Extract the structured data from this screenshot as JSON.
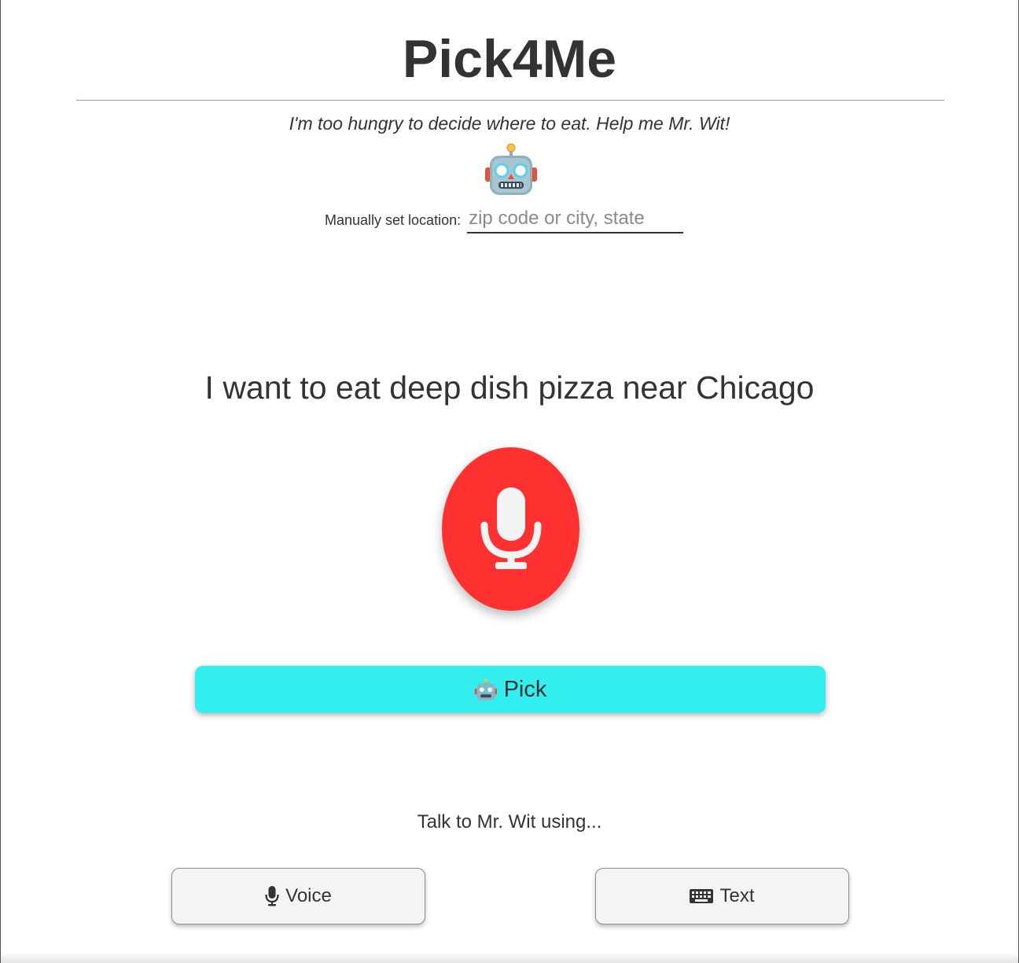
{
  "header": {
    "title": "Pick4Me",
    "subtitle": "I'm too hungry to decide where to eat. Help me Mr. Wit!"
  },
  "location": {
    "label": "Manually set location:",
    "placeholder": "zip code or city, state",
    "value": ""
  },
  "main": {
    "prompt": "I want to eat deep dish pizza near Chicago",
    "mic_color": "#ff3131",
    "pick_label": "Pick",
    "pick_color": "#33eeee"
  },
  "modes": {
    "intro": "Talk to Mr. Wit using...",
    "voice_label": "Voice",
    "text_label": "Text",
    "voice_icon": "microphone-icon",
    "text_icon": "keyboard-icon"
  },
  "icons": {
    "mascot": "robot-icon",
    "mic": "microphone-icon"
  }
}
